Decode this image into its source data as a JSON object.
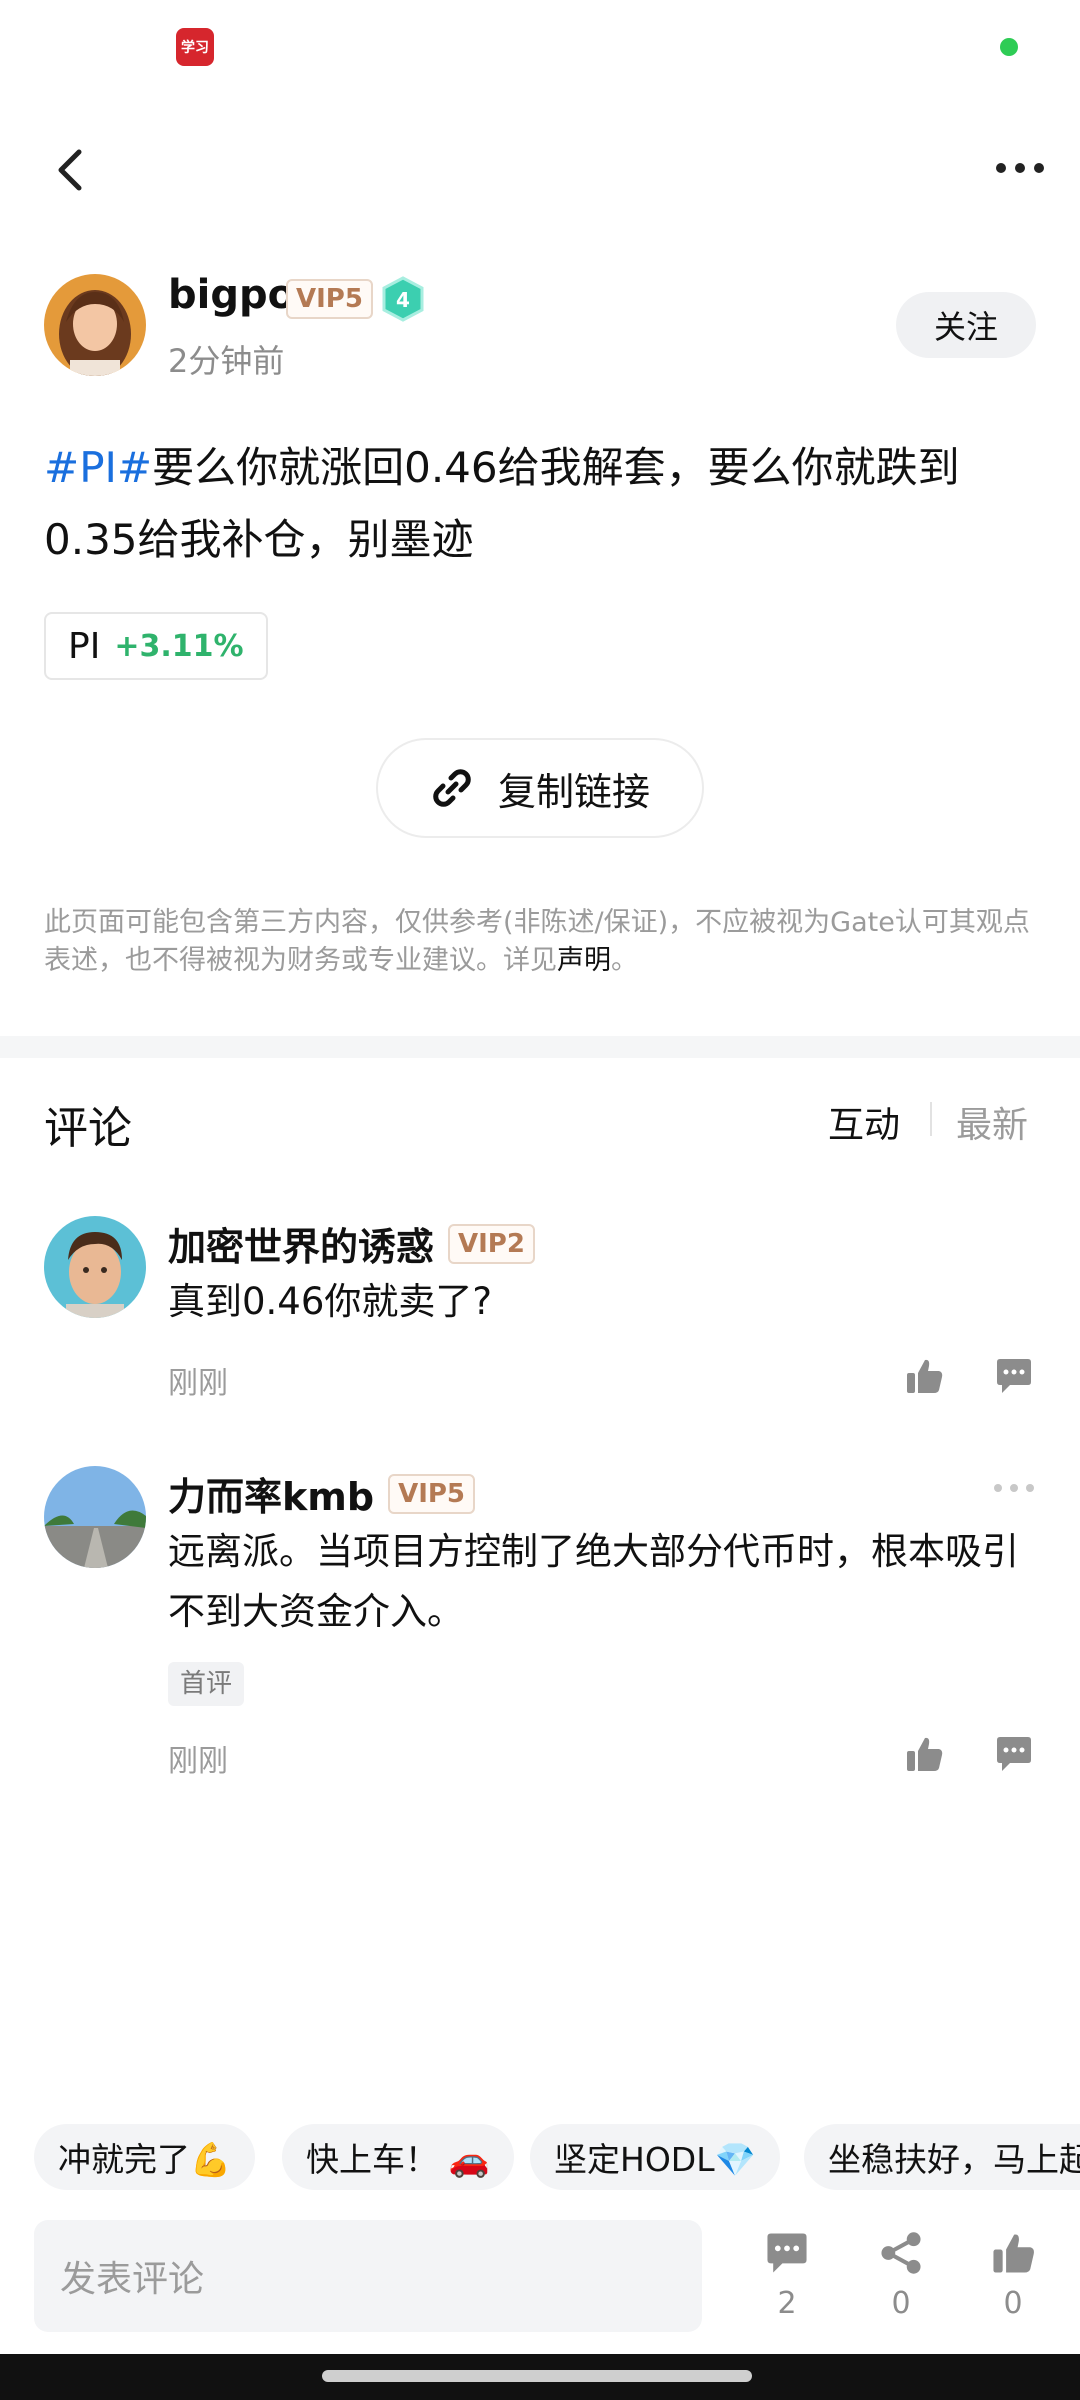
{
  "status_bar": {
    "app_icon_text": "学习"
  },
  "author": {
    "name": "bigpo",
    "vip": "VIP5",
    "level": "4",
    "time": "2分钟前",
    "follow_label": "关注"
  },
  "post": {
    "hashtag": "#PI#",
    "text": "要么你就涨回0.46给我解套，要么你就跌到0.35给我补仓，别墨迹",
    "ticker": {
      "symbol": "PI",
      "change": "+3.11%"
    },
    "copy_link_label": "复制链接",
    "disclaimer": "此页面可能包含第三方内容，仅供参考(非陈述/保证)，不应被视为Gate认可其观点表述，也不得被视为财务或专业建议。详见",
    "disclaimer_link": "声明",
    "disclaimer_end": "。"
  },
  "comments_section": {
    "title": "评论",
    "sort_options": [
      "互动",
      "最新"
    ],
    "items": [
      {
        "name": "加密世界的诱惑",
        "vip": "VIP2",
        "text": "真到0.46你就卖了?",
        "time": "刚刚"
      },
      {
        "name": "力而率kmb",
        "vip": "VIP5",
        "text": "远离派。当项目方控制了绝大部分代币时，根本吸引不到大资金介入。",
        "tag": "首评",
        "time": "刚刚"
      }
    ]
  },
  "quick_replies": [
    "冲就完了💪",
    "快上车！ 🚗",
    "坚定HODL💎",
    "坐稳扶好，马上起"
  ],
  "bottom_bar": {
    "input_placeholder": "发表评论",
    "comments_count": "2",
    "shares_count": "0",
    "likes_count": "0"
  },
  "colors": {
    "hashtag": "#1a6fde",
    "positive": "#2fb36c",
    "vip_text": "#b47a54",
    "muted": "#9b9b9b"
  }
}
